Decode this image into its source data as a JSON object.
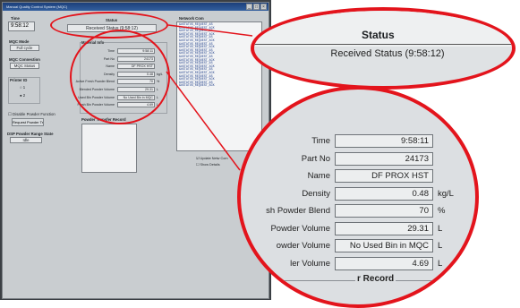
{
  "window": {
    "title": "Manual Quality Control System (MQC)"
  },
  "time": {
    "label": "Time",
    "value": "9:58:12"
  },
  "mqc_mode": {
    "label": "MQC Mode",
    "value": "Full cycle"
  },
  "mqc_connection": {
    "label": "MQC Connection",
    "value": "MQC Status"
  },
  "printer_id": {
    "label": "Printer ID",
    "options": [
      "1",
      "2"
    ]
  },
  "disable_powder": {
    "label": "Disable Powder Function"
  },
  "request_powder": {
    "label": "Request Powder Tr"
  },
  "dsp_state": {
    "label": "DSP Powder Range State",
    "value": "Idle"
  },
  "status": {
    "label": "Status",
    "value": "Received Status (9:58:12)"
  },
  "material": {
    "heading": "Material Info",
    "fields": [
      {
        "label": "Time",
        "value": "9:58:11",
        "unit": ""
      },
      {
        "label": "Part No",
        "value": "24173",
        "unit": ""
      },
      {
        "label": "Name",
        "value": "DF PROX HST",
        "unit": ""
      },
      {
        "label": "Density",
        "value": "0.48",
        "unit": "kg/L"
      },
      {
        "label": "Active Fresh Powder Blend",
        "value": "70",
        "unit": "%"
      },
      {
        "label": "Blended Powder Volume",
        "value": "29.31",
        "unit": "L"
      },
      {
        "label": "Used Bin Powder Volume",
        "value": "No Used Bin in MQC",
        "unit": "L"
      },
      {
        "label": "Fresh Bin Powder Volume",
        "value": "4.69",
        "unit": "L"
      }
    ]
  },
  "transfer": {
    "heading": "Powder Transfer Record"
  },
  "network": {
    "heading": "Network Com",
    "lines": [
      "&#STATUS_REQUEST_&S",
      "&#STATUS_REQUEST_ACK",
      "&#STATUS_REQUEST_&S",
      "&#STATUS_REQUEST_ACK",
      "&#STATUS_REQUEST_&S",
      "&#STATUS_REQUEST_ACK",
      "&#STATUS_REQUEST_&S",
      "&#STATUS_REQUEST_ACK",
      "&#STATUS_REQUEST_&S",
      "&#STATUS_REQUEST_ACK",
      "&#STATUS_REQUEST_&S",
      "&#STATUS_REQUEST_ACK",
      "&#STATUS_REQUEST_&S",
      "&#STATUS_REQUEST_ACK",
      "&#STATUS_REQUEST_&S",
      "&#STATUS_REQUEST_ACK",
      "&#STATUS_REQUEST_&S",
      "&#STATUS_REQUEST_ACK",
      "&#STATUS_REQUEST_&S",
      "&#STATUS_REQUEST_ACK"
    ],
    "update_label": "Update Netw Com",
    "details_label": "Show Details"
  },
  "zoom": {
    "status_label": "Status",
    "status_value": "Received Status (9:58:12)",
    "fields": [
      {
        "label": "Time",
        "value": "9:58:11",
        "unit": ""
      },
      {
        "label": "Part No",
        "value": "24173",
        "unit": ""
      },
      {
        "label": "Name",
        "value": "DF PROX HST",
        "unit": ""
      },
      {
        "label": "Density",
        "value": "0.48",
        "unit": "kg/L"
      },
      {
        "label": "sh Powder Blend",
        "value": "70",
        "unit": "%"
      },
      {
        "label": "Powder Volume",
        "value": "29.31",
        "unit": "L"
      },
      {
        "label": "owder Volume",
        "value": "No Used Bin in MQC",
        "unit": "L"
      },
      {
        "label": "ler Volume",
        "value": "4.69",
        "unit": "L"
      }
    ],
    "record_label": "r Record"
  },
  "colors": {
    "highlight": "#e3141c",
    "title_bar": "#1c3f7a"
  }
}
